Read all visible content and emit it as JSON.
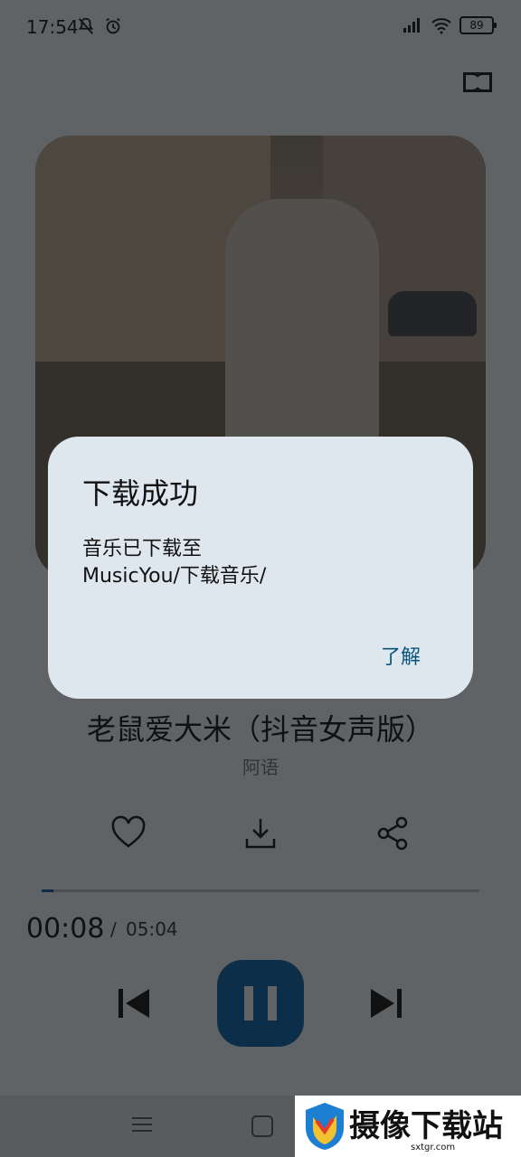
{
  "status": {
    "time": "17:54",
    "battery": "89"
  },
  "dialog": {
    "title": "下载成功",
    "message_line1": "音乐已下载至",
    "message_line2": "MusicYou/下载音乐/",
    "button": "了解"
  },
  "track": {
    "title": "老鼠爱大米（抖音女声版）",
    "artist": "阿语"
  },
  "playback": {
    "current_time": "00:08",
    "separator": "/",
    "total_time": "05:04",
    "progress": 0.026
  },
  "watermark": {
    "text": "摄像下载站",
    "url": "sxtgr.com"
  },
  "icons": {
    "like": "heart-icon",
    "download": "download-icon",
    "share": "share-icon",
    "prev": "skip-previous-icon",
    "play": "pause-icon",
    "next": "skip-next-icon"
  },
  "colors": {
    "accent": "#0d2e48",
    "dialog_bg": "#dfe7ee",
    "dialog_button": "#08567b",
    "background": "#5f6366"
  }
}
